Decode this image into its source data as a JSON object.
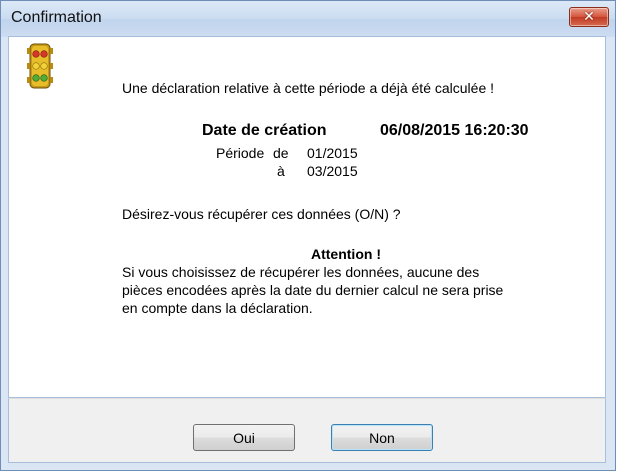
{
  "window": {
    "title": "Confirmation",
    "close_icon": "close-x-icon"
  },
  "message": {
    "icon": "traffic-light-icon",
    "intro": "Une déclaration relative à cette période a déjà été calculée !",
    "date_label": "Date de création",
    "date_value": "06/08/2015 16:20:30",
    "period_label": "Période",
    "period_from_label": "de",
    "period_from_value": "01/2015",
    "period_to_label": "à",
    "period_to_value": "03/2015",
    "question": "Désirez-vous récupérer ces données (O/N) ?",
    "attention_title": "Attention !",
    "attention_body": "Si vous choisissez de récupérer les données, aucune des\npièces encodées après la date du dernier calcul ne sera prise\nen compte dans la déclaration."
  },
  "buttons": {
    "yes_label": "Oui",
    "no_label": "Non"
  }
}
